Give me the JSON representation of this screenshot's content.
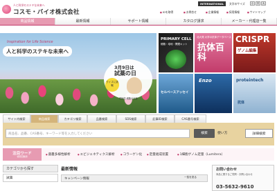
{
  "header": {
    "tagline": "人と科学のステキな未来へ",
    "company": "コスモ・バイオ株式会社",
    "international": "INTERNATIONAL",
    "font_size_label": "文字のサイズ",
    "font_sizes": [
      "小",
      "中",
      "大"
    ],
    "links": [
      "IDを取得",
      "お問合せ",
      "企業情報",
      "採用情報",
      "サイトマップ"
    ]
  },
  "nav": [
    "商品情報",
    "最新情報",
    "サポート情報",
    "カタログ請求",
    "メーカー・代理店一覧"
  ],
  "hero": {
    "inspiration": "Inspiration for Life Science",
    "headline": "人と科学のステキな未来へ",
    "event_date": "3月9日は",
    "event_day": "試薬の日",
    "badge": "クイズに挑戦",
    "person_caption": "学術的 細胞の元祖"
  },
  "banners": {
    "b1": {
      "title": "PRIMARY CELL",
      "sub": "細胞・培地・関連キット"
    },
    "b2": {
      "top": "北大発 大学の抗体データベース",
      "big": "抗体百科"
    },
    "b3": {
      "title": "CRISPR",
      "sub": "ゲノム編集"
    },
    "b4": {
      "title": "セルベースアッセイ"
    },
    "b5": {
      "title": "Enzo"
    },
    "b6": {
      "title": "proteintech",
      "sub": "抗体"
    }
  },
  "search": {
    "tabs": [
      "サイト内検索",
      "商品検索",
      "カテゴリ検索",
      "品番検索",
      "SDS検索",
      "記事ID検索",
      "CAS番号検索"
    ],
    "active_tab": "商品検索",
    "placeholder": "商品名、品番、CAS番号、キーワード等を入力してください",
    "button": "検索",
    "howto": "使い方",
    "advanced": "詳細検索"
  },
  "hot_words": {
    "label": "注目ワード",
    "sub": "検索回数順",
    "items": [
      "菌叢多様性解析",
      "エピジェネティクス解析",
      "コラーゲン化",
      "定量組成装置",
      "1細胞ゲノム定量（Lumitera）"
    ]
  },
  "category": {
    "heading": "カテゴリから探す",
    "item": "試薬"
  },
  "news": {
    "title": "最新情報",
    "sub": "キャンペーン情報",
    "more": "一覧を見る"
  },
  "contact": {
    "title": "お問い合わせ",
    "sub": "商品に関するご質問・お問い合わせ",
    "tel": "03-5632-9610"
  }
}
